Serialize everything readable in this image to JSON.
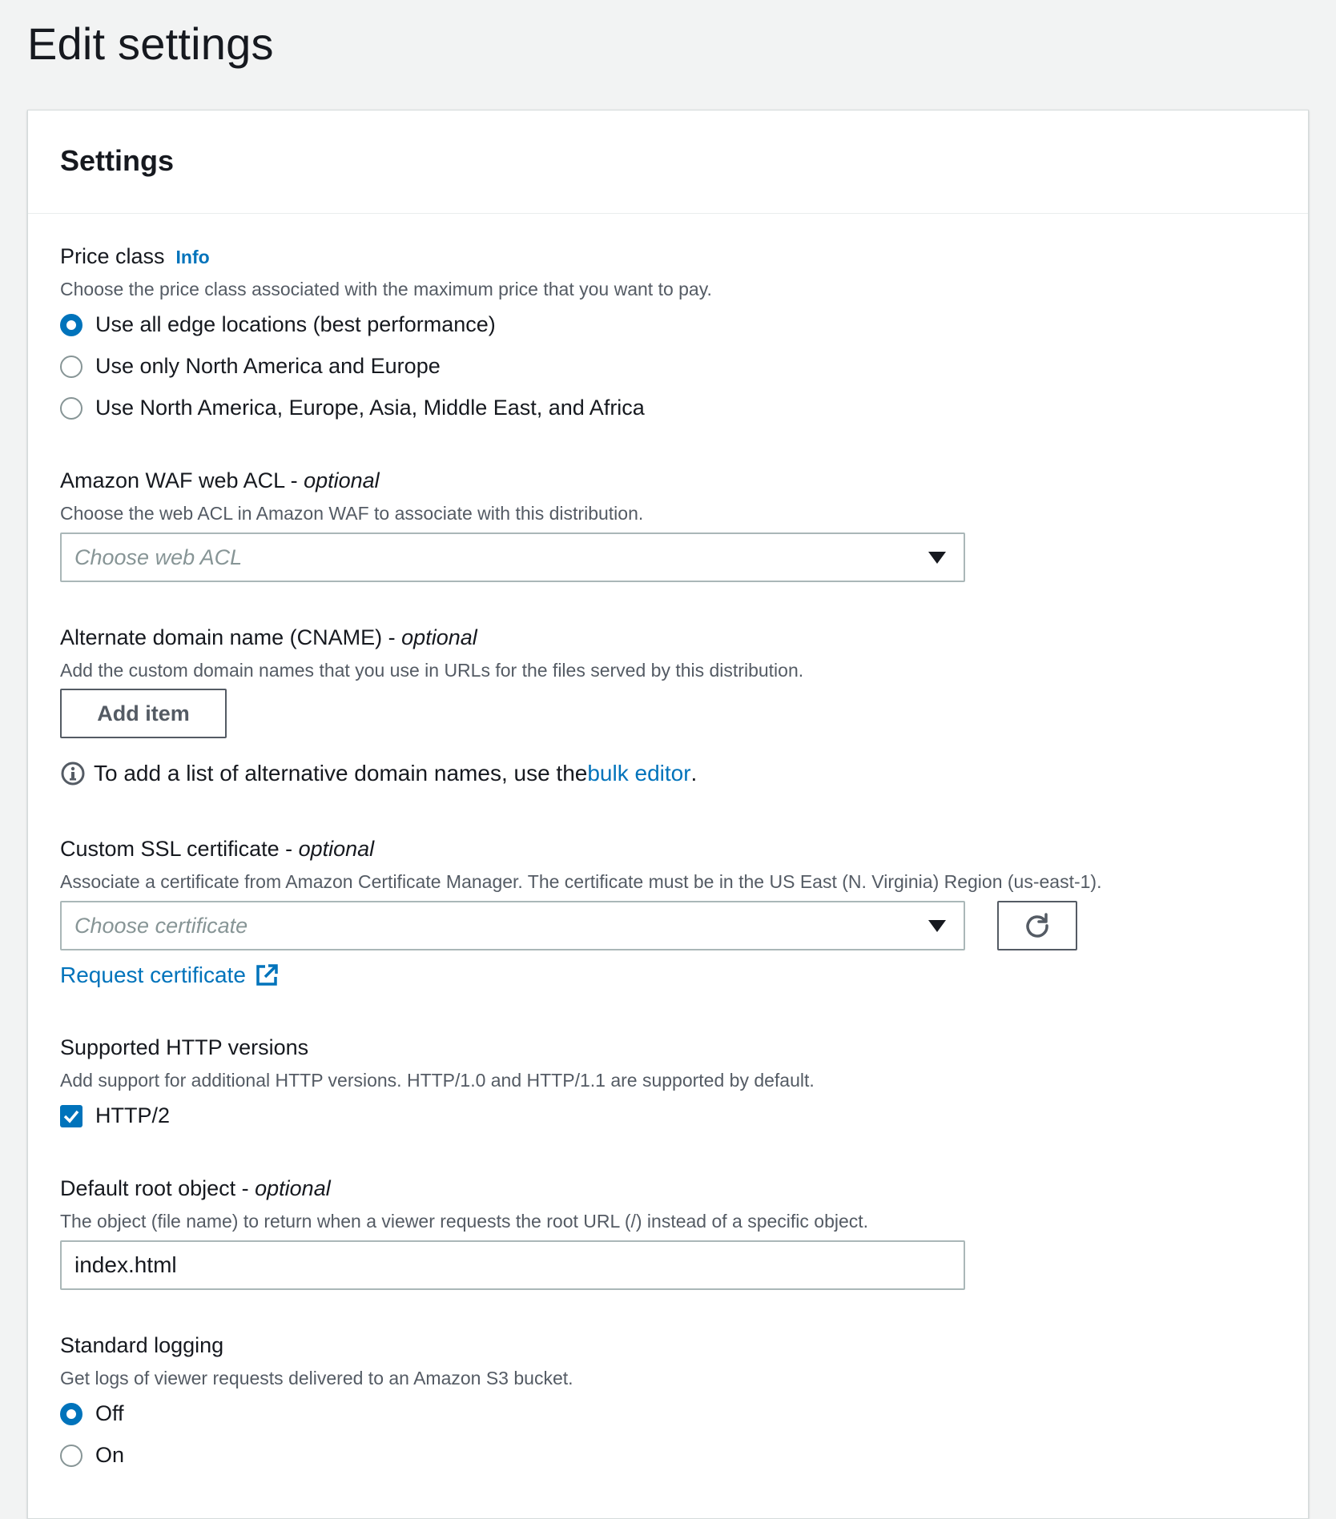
{
  "page": {
    "title": "Edit settings"
  },
  "panel": {
    "title": "Settings"
  },
  "price_class": {
    "label": "Price class",
    "info_link": "Info",
    "description": "Choose the price class associated with the maximum price that you want to pay.",
    "options": [
      {
        "label": "Use all edge locations (best performance)",
        "selected": true
      },
      {
        "label": "Use only North America and Europe",
        "selected": false
      },
      {
        "label": "Use North America, Europe, Asia, Middle East, and Africa",
        "selected": false
      }
    ]
  },
  "waf": {
    "label": "Amazon WAF web ACL - ",
    "optional": "optional",
    "description": "Choose the web ACL in Amazon WAF to associate with this distribution.",
    "placeholder": "Choose web ACL"
  },
  "cname": {
    "label": "Alternate domain name (CNAME) - ",
    "optional": "optional",
    "description": "Add the custom domain names that you use in URLs for the files served by this distribution.",
    "add_button": "Add item",
    "hint_prefix": "To add a list of alternative domain names, use the ",
    "hint_link": "bulk editor",
    "hint_suffix": "."
  },
  "ssl": {
    "label": "Custom SSL certificate - ",
    "optional": "optional",
    "description": "Associate a certificate from Amazon Certificate Manager. The certificate must be in the US East (N. Virginia) Region (us-east-1).",
    "placeholder": "Choose certificate",
    "request_link": "Request certificate"
  },
  "http": {
    "label": "Supported HTTP versions",
    "description": "Add support for additional HTTP versions. HTTP/1.0 and HTTP/1.1 are supported by default.",
    "option": "HTTP/2",
    "checked": true
  },
  "root_object": {
    "label": "Default root object - ",
    "optional": "optional",
    "description": "The object (file name) to return when a viewer requests the root URL (/) instead of a specific object.",
    "value": "index.html"
  },
  "logging": {
    "label": "Standard logging",
    "description": "Get logs of viewer requests delivered to an Amazon S3 bucket.",
    "options": [
      {
        "label": "Off",
        "selected": true
      },
      {
        "label": "On",
        "selected": false
      }
    ]
  },
  "colors": {
    "accent": "#0073bb",
    "text": "#16191f",
    "muted": "#545b64",
    "background": "#f2f3f3"
  },
  "icons": {
    "info": "info-circle-icon",
    "external": "external-link-icon",
    "refresh": "refresh-icon",
    "caret": "caret-down-icon",
    "check": "checkmark-icon"
  }
}
